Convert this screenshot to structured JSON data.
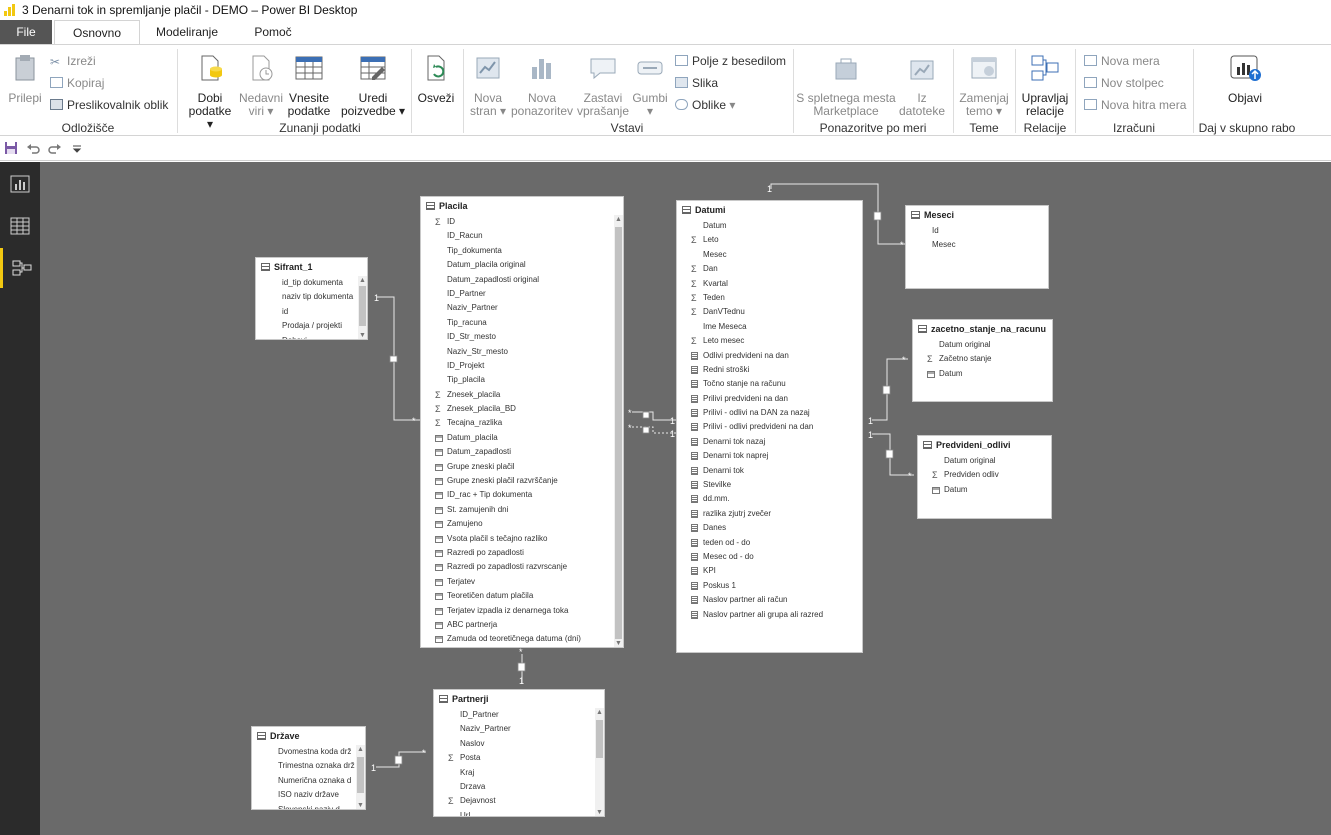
{
  "window": {
    "title": "3 Denarni tok in spremljanje plačil - DEMO – Power BI Desktop"
  },
  "tabs": [
    {
      "label": "File"
    },
    {
      "label": "Osnovno"
    },
    {
      "label": "Modeliranje"
    },
    {
      "label": "Pomoč"
    }
  ],
  "ribbon": {
    "paste": "Prilepi",
    "cut": "Izreži",
    "copy": "Kopiraj",
    "format_painter": "Preslikovalnik oblik",
    "get_data_1": "Dobi",
    "get_data_2": "podatke",
    "recent_1": "Nedavni",
    "recent_2": "viri",
    "enter_1": "Vnesite",
    "enter_2": "podatke",
    "edit_1": "Uredi",
    "edit_2": "poizvedbe",
    "refresh": "Osveži",
    "new_page_1": "Nova",
    "new_page_2": "stran",
    "new_visual_1": "Nova",
    "new_visual_2": "ponazoritev",
    "ask_1": "Zastavi",
    "ask_2": "vprašanje",
    "buttons": "Gumbi",
    "textbox": "Polje z besedilom",
    "image": "Slika",
    "shapes": "Oblike",
    "marketplace_1": "S spletnega mesta",
    "marketplace_2": "Marketplace",
    "from_file_1": "Iz",
    "from_file_2": "datoteke",
    "theme_1": "Zamenjaj",
    "theme_2": "temo",
    "relations_1": "Upravljaj",
    "relations_2": "relacije",
    "new_measure": "Nova mera",
    "new_column": "Nov stolpec",
    "quick_measure": "Nova hitra mera",
    "publish": "Objavi",
    "groups": {
      "clipboard": "Odložišče",
      "external": "Zunanji podatki",
      "insert": "Vstavi",
      "custom_visuals": "Ponazoritve po meri",
      "themes": "Teme",
      "relationships": "Relacije",
      "calculations": "Izračuni",
      "share": "Daj v skupno rabo"
    }
  },
  "tables": {
    "placila": {
      "name": "Placila",
      "fields": [
        {
          "n": "ID",
          "t": "sum"
        },
        {
          "n": "ID_Racun",
          "t": ""
        },
        {
          "n": "Tip_dokumenta",
          "t": ""
        },
        {
          "n": "Datum_placila original",
          "t": ""
        },
        {
          "n": "Datum_zapadlosti original",
          "t": ""
        },
        {
          "n": "ID_Partner",
          "t": ""
        },
        {
          "n": "Naziv_Partner",
          "t": ""
        },
        {
          "n": "Tip_racuna",
          "t": ""
        },
        {
          "n": "ID_Str_mesto",
          "t": ""
        },
        {
          "n": "Naziv_Str_mesto",
          "t": ""
        },
        {
          "n": "ID_Projekt",
          "t": ""
        },
        {
          "n": "Tip_placila",
          "t": ""
        },
        {
          "n": "Znesek_placila",
          "t": "sum"
        },
        {
          "n": "Znesek_placila_BD",
          "t": "sum"
        },
        {
          "n": "Tecajna_razlika",
          "t": "sum"
        },
        {
          "n": "Datum_placila",
          "t": "calc"
        },
        {
          "n": "Datum_zapadlosti",
          "t": "calc"
        },
        {
          "n": "Grupe zneski plačil",
          "t": "calc"
        },
        {
          "n": "Grupe zneski plačil razvrščanje",
          "t": "calc"
        },
        {
          "n": "ID_rac + Tip dokumenta",
          "t": "calc"
        },
        {
          "n": "St. zamujenih dni",
          "t": "calc"
        },
        {
          "n": "Zamujeno",
          "t": "calc"
        },
        {
          "n": "Vsota plačil s tečajno razliko",
          "t": "calc"
        },
        {
          "n": "Razredi po zapadlosti",
          "t": "calc"
        },
        {
          "n": "Razredi po zapadlosti razvrscanje",
          "t": "calc"
        },
        {
          "n": "Terjatev",
          "t": "calc"
        },
        {
          "n": "Teoretičen datum plačila",
          "t": "calc"
        },
        {
          "n": "Terjatev izpadla iz denarnega toka",
          "t": "calc"
        },
        {
          "n": "ABC partnerja",
          "t": "calc"
        },
        {
          "n": "Zamuda od teoretičnega datuma (dni)",
          "t": "calc"
        }
      ]
    },
    "datumi": {
      "name": "Datumi",
      "fields": [
        {
          "n": "Datum",
          "t": ""
        },
        {
          "n": "Leto",
          "t": "sum"
        },
        {
          "n": "Mesec",
          "t": ""
        },
        {
          "n": "Dan",
          "t": "sum"
        },
        {
          "n": "Kvartal",
          "t": "sum"
        },
        {
          "n": "Teden",
          "t": "sum"
        },
        {
          "n": "DanVTednu",
          "t": "sum"
        },
        {
          "n": "Ime Meseca",
          "t": ""
        },
        {
          "n": "Leto mesec",
          "t": "sum"
        },
        {
          "n": "Odlivi predvideni na dan",
          "t": "meas"
        },
        {
          "n": "Redni stroški",
          "t": "meas"
        },
        {
          "n": "Točno stanje na računu",
          "t": "meas"
        },
        {
          "n": "Prilivi predvideni na dan",
          "t": "meas"
        },
        {
          "n": "Prilivi - odlivi na DAN za nazaj",
          "t": "meas"
        },
        {
          "n": "Prilivi - odlivi predvideni na dan",
          "t": "meas"
        },
        {
          "n": "Denarni tok nazaj",
          "t": "meas"
        },
        {
          "n": "Denarni tok naprej",
          "t": "meas"
        },
        {
          "n": "Denarni tok",
          "t": "meas"
        },
        {
          "n": "Stevilke",
          "t": "meas"
        },
        {
          "n": "dd.mm.",
          "t": "meas"
        },
        {
          "n": "razlika zjutrj zvečer",
          "t": "meas"
        },
        {
          "n": "Danes",
          "t": "meas"
        },
        {
          "n": "teden od - do",
          "t": "meas"
        },
        {
          "n": "Mesec od - do",
          "t": "meas"
        },
        {
          "n": "KPI",
          "t": "meas"
        },
        {
          "n": "Poskus 1",
          "t": "meas"
        },
        {
          "n": "Naslov partner ali račun",
          "t": "meas"
        },
        {
          "n": "Naslov partner ali grupa ali razred",
          "t": "meas"
        }
      ]
    },
    "meseci": {
      "name": "Meseci",
      "fields": [
        {
          "n": "Id",
          "t": ""
        },
        {
          "n": "Mesec",
          "t": ""
        }
      ]
    },
    "zacetno": {
      "name": "zacetno_stanje_na_racunu",
      "fields": [
        {
          "n": "Datum original",
          "t": ""
        },
        {
          "n": "Začetno stanje",
          "t": "sum"
        },
        {
          "n": "Datum",
          "t": "calc"
        }
      ]
    },
    "predvideni": {
      "name": "Predvideni_odlivi",
      "fields": [
        {
          "n": "Datum original",
          "t": ""
        },
        {
          "n": "Predviden odliv",
          "t": "sum"
        },
        {
          "n": "Datum",
          "t": "calc"
        }
      ]
    },
    "sifrant": {
      "name": "Sifrant_1",
      "fields": [
        {
          "n": "id_tip dokumenta",
          "t": ""
        },
        {
          "n": "naziv tip dokumenta",
          "t": ""
        },
        {
          "n": "id",
          "t": ""
        },
        {
          "n": "Prodaja / projekti",
          "t": ""
        },
        {
          "n": "Dobavi...",
          "t": ""
        }
      ]
    },
    "partnerji": {
      "name": "Partnerji",
      "fields": [
        {
          "n": "ID_Partner",
          "t": ""
        },
        {
          "n": "Naziv_Partner",
          "t": ""
        },
        {
          "n": "Naslov",
          "t": ""
        },
        {
          "n": "Posta",
          "t": "sum"
        },
        {
          "n": "Kraj",
          "t": ""
        },
        {
          "n": "Drzava",
          "t": ""
        },
        {
          "n": "Dejavnost",
          "t": "sum"
        },
        {
          "n": "Url...",
          "t": ""
        }
      ]
    },
    "drzave": {
      "name": "Države",
      "fields": [
        {
          "n": "Dvomestna koda drž",
          "t": ""
        },
        {
          "n": "Trimestna oznaka drž",
          "t": ""
        },
        {
          "n": "Numerična oznaka d",
          "t": ""
        },
        {
          "n": "ISO naziv države",
          "t": ""
        },
        {
          "n": "Slovenski naziv d...",
          "t": ""
        }
      ]
    }
  },
  "relationship_labels": {
    "one": "1",
    "many": "*"
  }
}
